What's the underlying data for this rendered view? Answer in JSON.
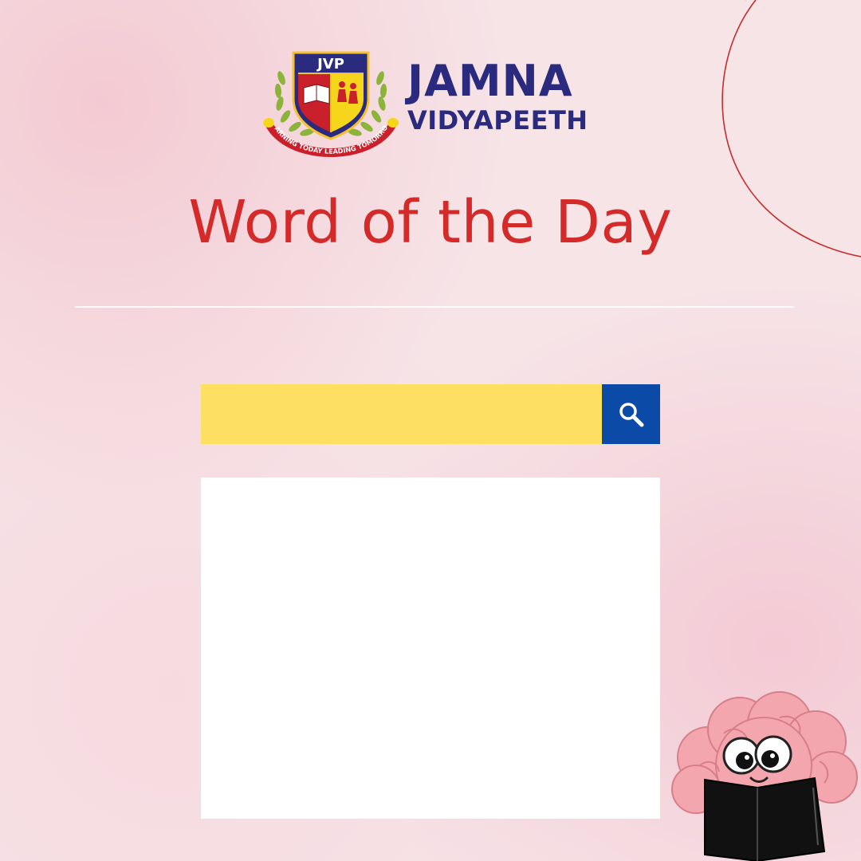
{
  "brand": {
    "emblem_text": "JVP",
    "motto": "LEARNING TODAY LEADING TOMORROW",
    "name_line1": "JAMNA",
    "name_line2": "VIDYAPEETH",
    "name_color": "#2a2a7e"
  },
  "page": {
    "title": "Word of the Day",
    "title_color": "#d42a29",
    "background_color": "#f6e4e7"
  },
  "search": {
    "value": "",
    "placeholder": "",
    "field_color": "#fddf62",
    "button_color": "#0b4aa6",
    "button_icon": "search-icon"
  },
  "content_box": {
    "text": ""
  },
  "mascot": {
    "icon": "brain-reading-book-icon"
  }
}
